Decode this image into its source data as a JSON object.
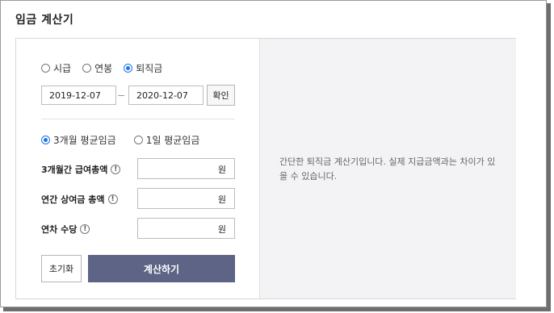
{
  "card": {
    "title": "임금 계산기"
  },
  "mode_options": [
    {
      "label": "시급",
      "checked": false
    },
    {
      "label": "연봉",
      "checked": false
    },
    {
      "label": "퇴직금",
      "checked": true
    }
  ],
  "date_range": {
    "start": "2019-12-07",
    "end": "2020-12-07",
    "confirm_label": "확인"
  },
  "wage_basis_options": [
    {
      "label": "3개월 평균임금",
      "checked": true
    },
    {
      "label": "1일 평균임금",
      "checked": false
    }
  ],
  "fields": [
    {
      "label": "3개월간 급여총액",
      "unit": "원",
      "value": ""
    },
    {
      "label": "연간 상여금 총액",
      "unit": "원",
      "value": ""
    },
    {
      "label": "연차 수당",
      "unit": "원",
      "value": ""
    }
  ],
  "buttons": {
    "reset": "초기화",
    "calculate": "계산하기"
  },
  "info_text": "간단한 퇴직금 계산기입니다. 실제 지급금액과는 차이가 있을 수 있습니다.",
  "colors": {
    "accent": "#1a73e8",
    "calc_button": "#5d6485",
    "result_bg": "#f3f3f5"
  }
}
